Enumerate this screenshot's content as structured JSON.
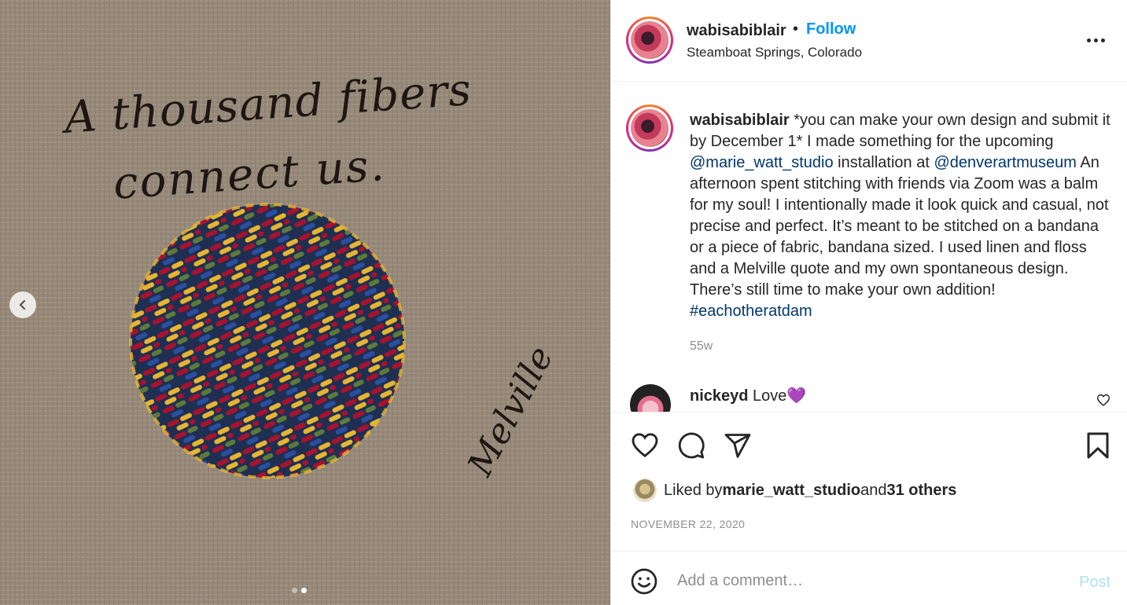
{
  "media": {
    "quote_line1": "A thousand fibers",
    "quote_line2": "connect us.",
    "signature": "Melville",
    "slide_count": 2,
    "active_slide": 2
  },
  "header": {
    "username": "wabisabiblair",
    "separator": "•",
    "follow_label": "Follow",
    "location": "Steamboat Springs, Colorado"
  },
  "caption": {
    "username": "wabisabiblair",
    "text_part1": " *you can make your own design and submit it by December 1* I made something for the upcoming ",
    "mention1": "@marie_watt_studio",
    "text_part2": " installation at ",
    "mention2": "@denverartmuseum",
    "text_part3": " An afternoon spent stitching with friends via Zoom was a balm for my soul! I intentionally made it look quick and casual, not precise and perfect. It’s meant to be stitched on a bandana or a piece of fabric, bandana sized. I used linen and floss and a Melville quote and my own spontaneous design. There’s still time to make your own addition! ",
    "hashtag": "#eachotheratdam",
    "time_ago": "55w"
  },
  "comments": [
    {
      "username": "nickeyd",
      "text": " Love💜"
    }
  ],
  "likes": {
    "prefix": "Liked by ",
    "user": "marie_watt_studio",
    "middle": " and ",
    "others": "31 others"
  },
  "date": "NOVEMBER 22, 2020",
  "comment_box": {
    "placeholder": "Add a comment…",
    "post_label": "Post"
  },
  "colors": {
    "follow": "#0095f6",
    "mention": "#00376b",
    "post_disabled": "#b2dffc"
  }
}
